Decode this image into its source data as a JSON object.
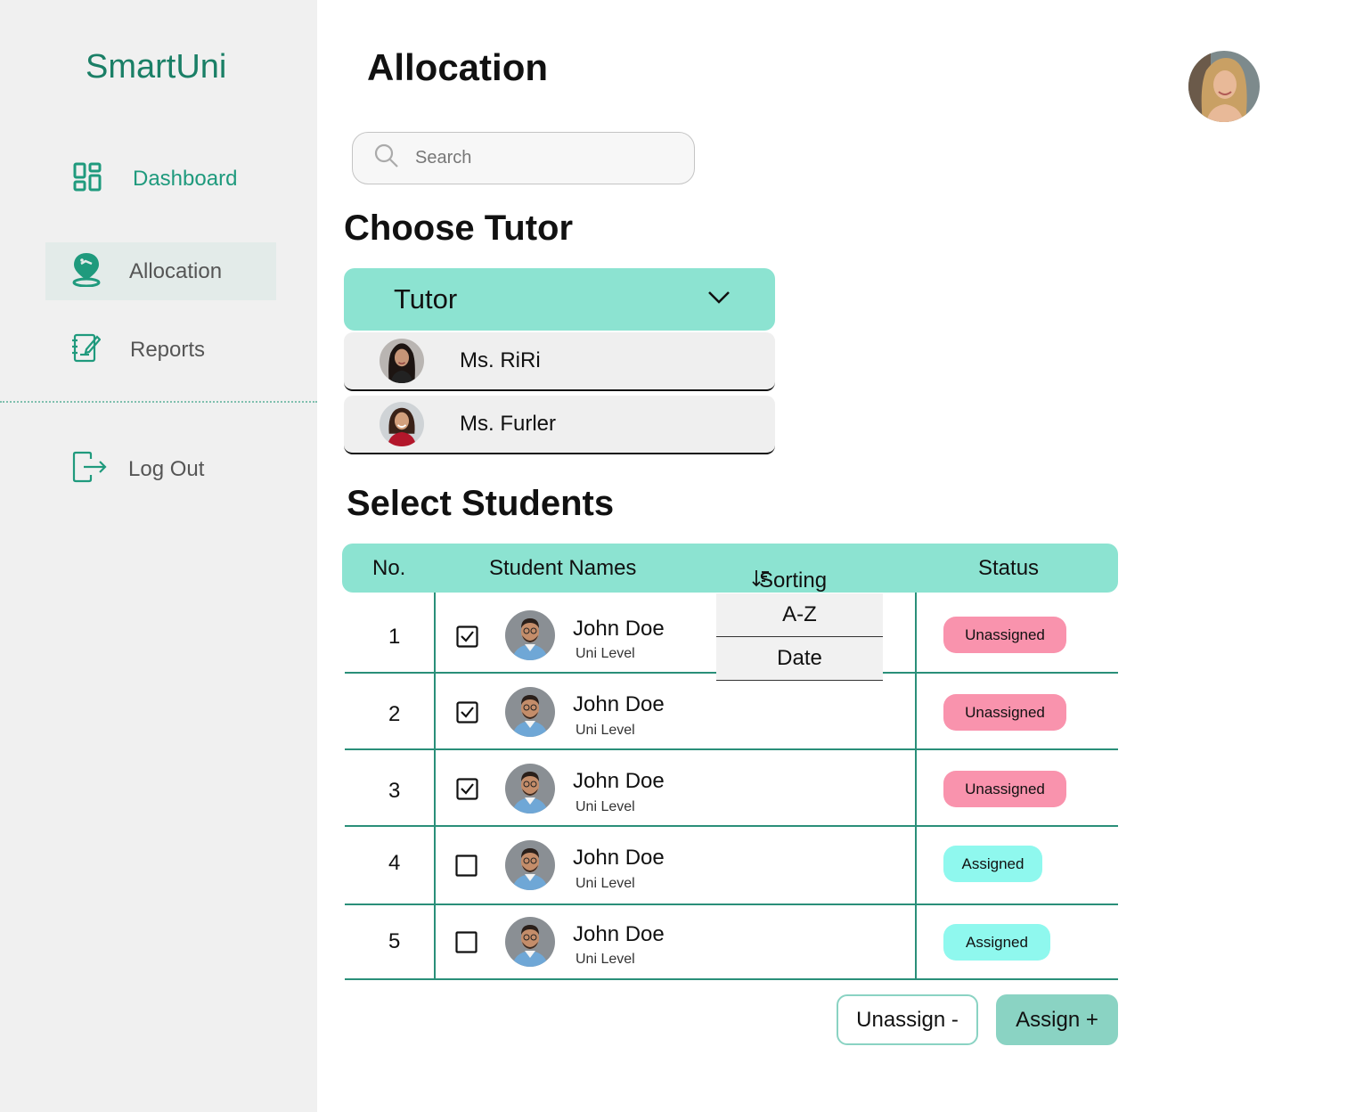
{
  "app": {
    "brand": "SmartUni"
  },
  "sidebar": {
    "items": [
      {
        "label": "Dashboard",
        "icon": "dashboard-grid-icon",
        "active": false
      },
      {
        "label": "Allocation",
        "icon": "location-pin-icon",
        "active": true
      },
      {
        "label": "Reports",
        "icon": "notebook-edit-icon",
        "active": false
      }
    ],
    "logout": {
      "label": "Log Out",
      "icon": "logout-icon"
    }
  },
  "header": {
    "title": "Allocation",
    "user_avatar": "user-avatar"
  },
  "search": {
    "placeholder": "Search",
    "icon": "search-icon"
  },
  "choose_tutor": {
    "title": "Choose Tutor",
    "dropdown_label": "Tutor",
    "options": [
      {
        "name": "Ms. RiRi"
      },
      {
        "name": "Ms. Furler"
      }
    ]
  },
  "students": {
    "title": "Select Students",
    "columns": {
      "no": "No.",
      "names": "Student Names",
      "sorting": "Sorting",
      "status": "Status"
    },
    "sort_options": [
      "A-Z",
      "Date"
    ],
    "rows": [
      {
        "no": "1",
        "checked": true,
        "name": "John Doe",
        "level": "Uni Level",
        "status": "Unassigned"
      },
      {
        "no": "2",
        "checked": true,
        "name": "John Doe",
        "level": "Uni Level",
        "status": "Unassigned"
      },
      {
        "no": "3",
        "checked": true,
        "name": "John Doe",
        "level": "Uni Level",
        "status": "Unassigned"
      },
      {
        "no": "4",
        "checked": false,
        "name": "John Doe",
        "level": "Uni Level",
        "status": "Assigned"
      },
      {
        "no": "5",
        "checked": false,
        "name": "John Doe",
        "level": "Uni Level",
        "status": "Assigned"
      }
    ]
  },
  "actions": {
    "unassign": "Unassign -",
    "assign": "Assign +"
  },
  "colors": {
    "accent": "#8ce3d1",
    "brand": "#1a7f66",
    "unassigned": "#f993ad",
    "assigned": "#8ff8ee",
    "sidebar_bg": "#f0f0f0"
  }
}
